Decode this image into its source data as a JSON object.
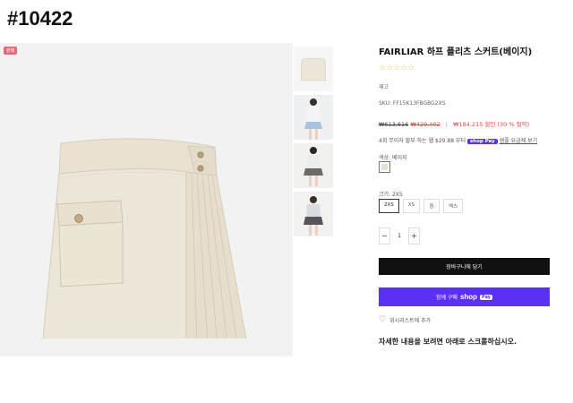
{
  "page_id": "#10422",
  "product": {
    "badge": "판매",
    "title": "FAIRLIAR 하프 플리츠 스커트(베이지)",
    "rating_stars": "☆☆☆☆☆",
    "stock": "재고",
    "sku": "SKU: FF15K13FBGBG2XS",
    "price": {
      "original": "₩613,616",
      "strike": "₩429,402",
      "separator": "|",
      "current": "₩184,215",
      "discount_label": "할인",
      "discount_pct": "(30 % 절약)"
    },
    "installments": {
      "text": "4회 무이자 할부 하는 웹 $29.88 부터",
      "shop_pay": "shop Pay",
      "learn_more": "샘플 요금제 보기"
    },
    "color": {
      "label": "색상: 베이지",
      "swatch_hex": "#e8e0cf"
    },
    "size": {
      "label": "크기: 2XS",
      "options": [
        "2XS",
        "XS",
        "중",
        "엑스"
      ],
      "selected_index": 0
    },
    "quantity": {
      "minus": "−",
      "value": "1",
      "plus": "+"
    },
    "cart_button": "장바구니에 담기",
    "buy_button": {
      "prefix": "함께 구매",
      "logo": "shop",
      "pay": "Pay"
    },
    "wishlist": "위시리스트에 추가",
    "notice": "자세한 내용을 보려면 아래로 스크롤하십시오."
  },
  "colors": {
    "skirt": "#ece6d8",
    "brand_purple": "#5a31f4",
    "sale_red": "#e14b4b"
  }
}
